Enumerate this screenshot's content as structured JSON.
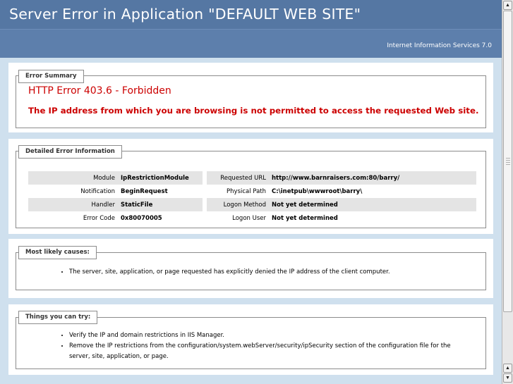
{
  "header": {
    "title": "Server Error in Application \"DEFAULT WEB SITE\"",
    "server_software": "Internet Information Services 7.0"
  },
  "error_summary": {
    "legend": "Error Summary",
    "title": "HTTP Error 403.6 - Forbidden",
    "message": "The IP address from which you are browsing is not permitted to access the requested Web site."
  },
  "detailed_info": {
    "legend": "Detailed Error Information",
    "rows": [
      {
        "label_left": "Module",
        "value_left": "IpRestrictionModule",
        "label_right": "Requested URL",
        "value_right": "http://www.barnraisers.com:80/barry/"
      },
      {
        "label_left": "Notification",
        "value_left": "BeginRequest",
        "label_right": "Physical Path",
        "value_right": "C:\\inetpub\\wwwroot\\barry\\"
      },
      {
        "label_left": "Handler",
        "value_left": "StaticFile",
        "label_right": "Logon Method",
        "value_right": "Not yet determined"
      },
      {
        "label_left": "Error Code",
        "value_left": "0x80070005",
        "label_right": "Logon User",
        "value_right": "Not yet determined"
      }
    ]
  },
  "causes": {
    "legend": "Most likely causes:",
    "items": [
      "The server, site, application, or page requested has explicitly denied the IP address of the client computer."
    ]
  },
  "things_to_try": {
    "legend": "Things you can try:",
    "items": [
      "Verify the IP and domain restrictions in IIS Manager.",
      "Remove the IP restrictions from the configuration/system.webServer/security/ipSecurity section of the configuration file for the server, site, application, or page."
    ]
  },
  "scrollbar": {
    "up_icon": "scroll-up-arrow-icon",
    "down_icon": "scroll-down-arrow-icon"
  }
}
